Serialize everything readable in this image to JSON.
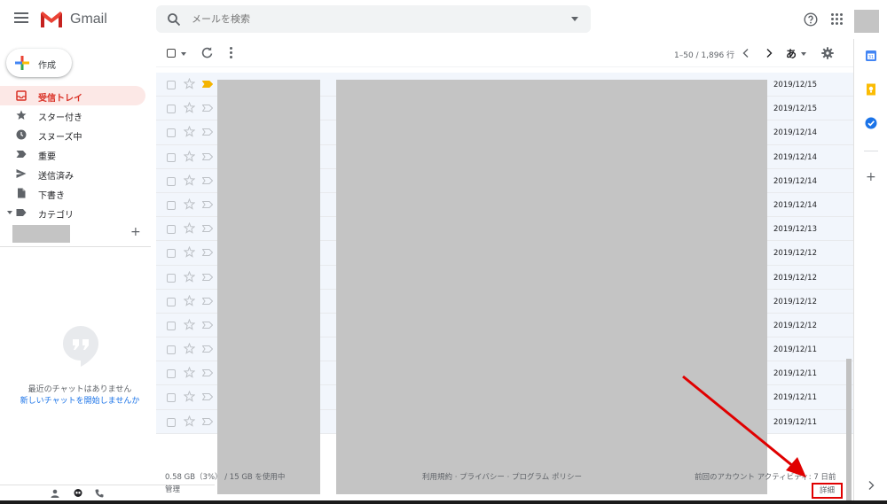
{
  "header": {
    "app_name": "Gmail",
    "search_placeholder": "メールを検索"
  },
  "compose": {
    "label": "作成"
  },
  "nav": {
    "items": [
      {
        "label": "受信トレイ",
        "active": true,
        "icon": "inbox-icon"
      },
      {
        "label": "スター付き",
        "icon": "star-icon"
      },
      {
        "label": "スヌーズ中",
        "icon": "clock-icon"
      },
      {
        "label": "重要",
        "icon": "important-icon"
      },
      {
        "label": "送信済み",
        "icon": "send-icon"
      },
      {
        "label": "下書き",
        "icon": "draft-icon"
      },
      {
        "label": "カテゴリ",
        "icon": "label-icon"
      }
    ]
  },
  "hangouts": {
    "add_label": "+",
    "empty_text": "最近のチャットはありません",
    "start_link": "新しいチャットを開始しませんか"
  },
  "toolbar": {
    "pager": "1–50 / 1,896 行",
    "ime_label": "あ"
  },
  "emails": [
    {
      "date": "2019/12/15",
      "important": true
    },
    {
      "date": "2019/12/15",
      "important": false
    },
    {
      "date": "2019/12/14",
      "important": false
    },
    {
      "date": "2019/12/14",
      "important": false
    },
    {
      "date": "2019/12/14",
      "important": false
    },
    {
      "date": "2019/12/14",
      "important": false
    },
    {
      "date": "2019/12/13",
      "important": false
    },
    {
      "date": "2019/12/12",
      "important": false
    },
    {
      "date": "2019/12/12",
      "important": false
    },
    {
      "date": "2019/12/12",
      "important": false
    },
    {
      "date": "2019/12/12",
      "important": false
    },
    {
      "date": "2019/12/11",
      "important": false
    },
    {
      "date": "2019/12/11",
      "important": false
    },
    {
      "date": "2019/12/11",
      "important": false
    },
    {
      "date": "2019/12/11",
      "important": false
    }
  ],
  "footer": {
    "storage": "0.58 GB（3%） / 15 GB を使用中",
    "manage": "管理",
    "terms": "利用規約 · プライバシー · プログラム ポリシー",
    "activity": "前回のアカウント アクティビティ: 7 日前",
    "details": "詳細"
  },
  "colors": {
    "accent_red": "#d93025",
    "active_bg": "#fce8e6",
    "highlight_box": "#e00000",
    "important_marker": "#f4b400",
    "link": "#1a73e8"
  }
}
